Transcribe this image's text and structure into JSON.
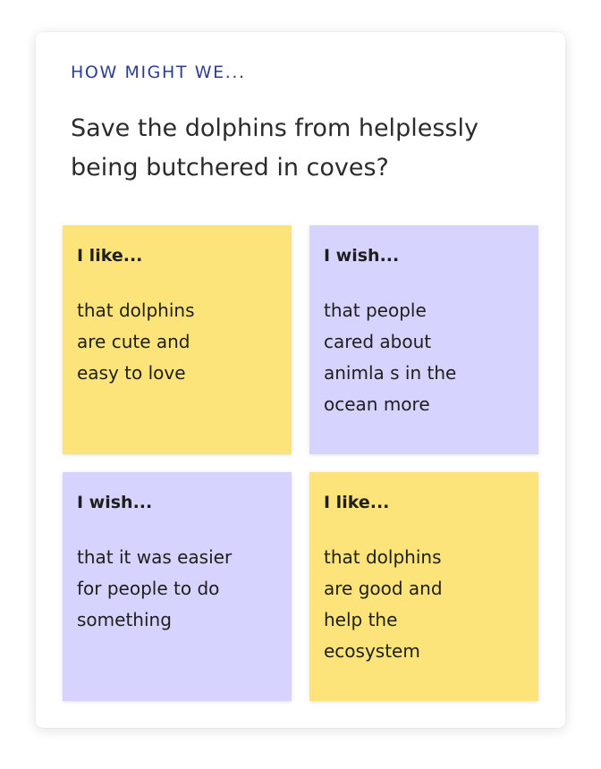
{
  "header": {
    "kicker": "HOW MIGHT WE...",
    "question": "Save the dolphins from helplessly being butchered in coves?"
  },
  "notes": [
    {
      "title": "I like...",
      "body": "that dolphins\nare cute and\neasy to love",
      "color": "#fde47a"
    },
    {
      "title": "I wish...",
      "body": "that people\ncared about\nanimla s in the\nocean more",
      "color": "#d6d4fe"
    },
    {
      "title": "I wish...",
      "body": "that it was easier\nfor people to do\nsomething",
      "color": "#d6d4fe"
    },
    {
      "title": "I like...",
      "body": "that dolphins\nare good and\nhelp the\necosystem",
      "color": "#fde47a"
    }
  ],
  "colors": {
    "kicker": "#2e3e8c",
    "text": "#2b2b2b",
    "yellow_note": "#fde47a",
    "purple_note": "#d6d4fe"
  }
}
